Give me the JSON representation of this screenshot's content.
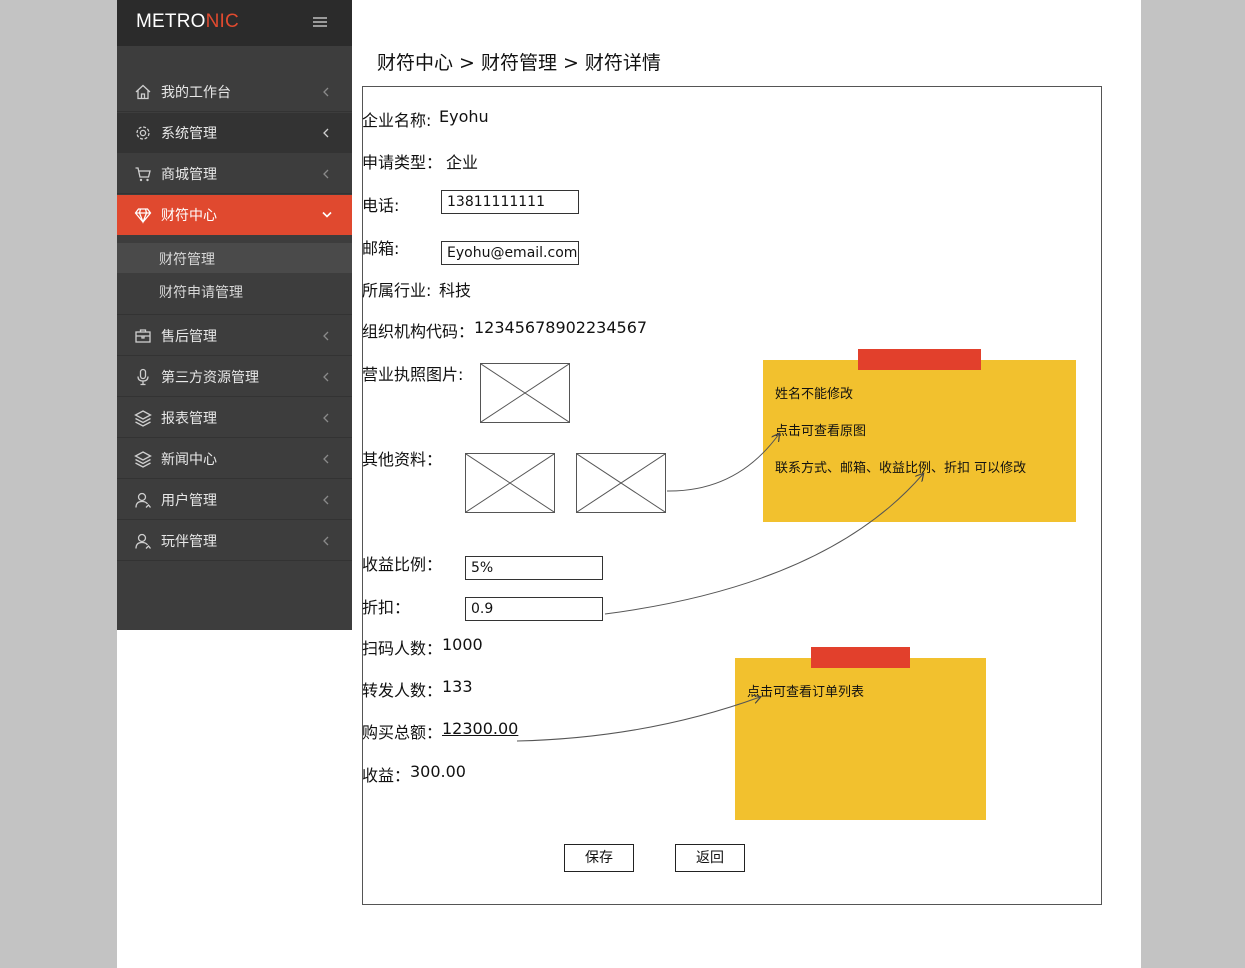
{
  "brand": {
    "logo_main": "METRO",
    "logo_accent": "NIC",
    "accent_color": "#e0492f"
  },
  "sidebar": {
    "items": [
      {
        "label": "我的工作台",
        "icon": "home-icon"
      },
      {
        "label": "系统管理",
        "icon": "gear-icon"
      },
      {
        "label": "商城管理",
        "icon": "cart-icon"
      },
      {
        "label": "财符中心",
        "icon": "diamond-icon"
      },
      {
        "label": "售后管理",
        "icon": "briefcase-icon"
      },
      {
        "label": "第三方资源管理",
        "icon": "microphone-icon"
      },
      {
        "label": "报表管理",
        "icon": "layers-icon"
      },
      {
        "label": "新闻中心",
        "icon": "layers-icon"
      },
      {
        "label": "用户管理",
        "icon": "user-icon"
      },
      {
        "label": "玩伴管理",
        "icon": "user-icon"
      }
    ],
    "submenu": [
      {
        "label": "财符管理"
      },
      {
        "label": "财符申请管理"
      }
    ]
  },
  "breadcrumb": [
    "财符中心",
    ">",
    "财符管理",
    ">",
    "财符详情"
  ],
  "form": {
    "company_label": "企业名称:",
    "company_value": "Eyohu",
    "type_label": "申请类型：",
    "type_value": "企业",
    "phone_label": "电话:",
    "phone_value": "13811111111",
    "email_label": "邮箱:",
    "email_value": "Eyohu@email.com",
    "industry_label": "所属行业:",
    "industry_value": "科技",
    "org_code_label": "组织机构代码：",
    "org_code_value": "12345678902234567",
    "license_label": "营业执照图片:",
    "other_label": "其他资料：",
    "ratio_label": "收益比例：",
    "ratio_value": "5%",
    "discount_label": "折扣：",
    "discount_value": "0.9",
    "scan_label": "扫码人数：",
    "scan_value": "1000",
    "forward_label": "转发人数：",
    "forward_value": "133",
    "purchase_label": "购买总额：",
    "purchase_value": "12300.00",
    "income_label": "收益：",
    "income_value": "300.00"
  },
  "buttons": {
    "save": "保存",
    "back": "返回"
  },
  "notes": {
    "note1": [
      "姓名不能修改",
      "点击可查看原图",
      "联系方式、邮箱、收益比例、折扣 可以修改"
    ],
    "note2": [
      "点击可查看订单列表"
    ],
    "note_color": "#f2c12e",
    "tape_color": "#e2402c"
  }
}
